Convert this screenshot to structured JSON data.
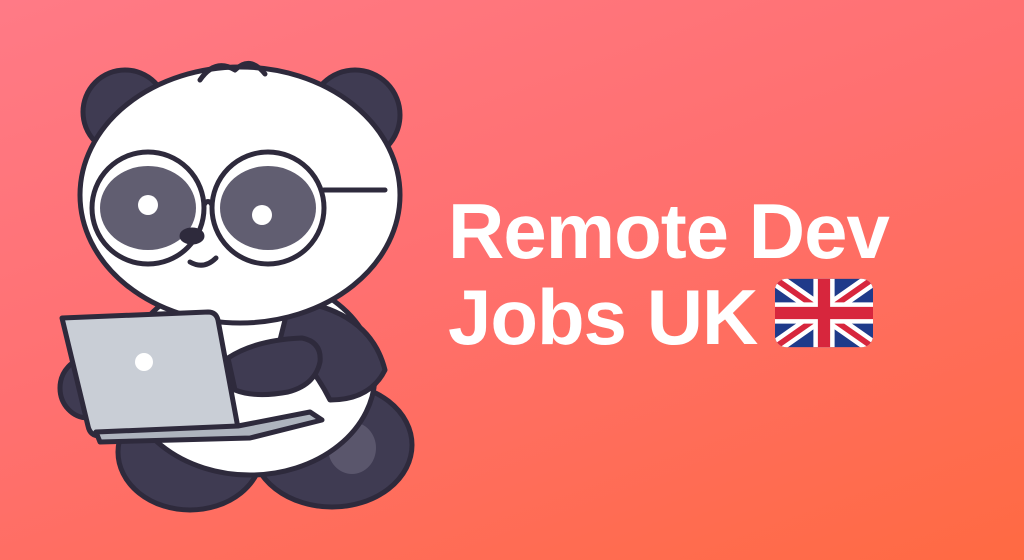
{
  "headline": {
    "line1": "Remote Dev",
    "line2": "Jobs UK"
  },
  "colors": {
    "background_top": "#ff7a86",
    "background_bottom": "#ff6a42",
    "headline_text": "#ffffff",
    "outline": "#2e2a3c",
    "fur_dark": "#3f3b52",
    "fur_light": "#ffffff",
    "laptop": "#c9ced6"
  },
  "icons": {
    "mascot": "panda-with-glasses-on-laptop",
    "flag": "uk-flag-icon"
  }
}
